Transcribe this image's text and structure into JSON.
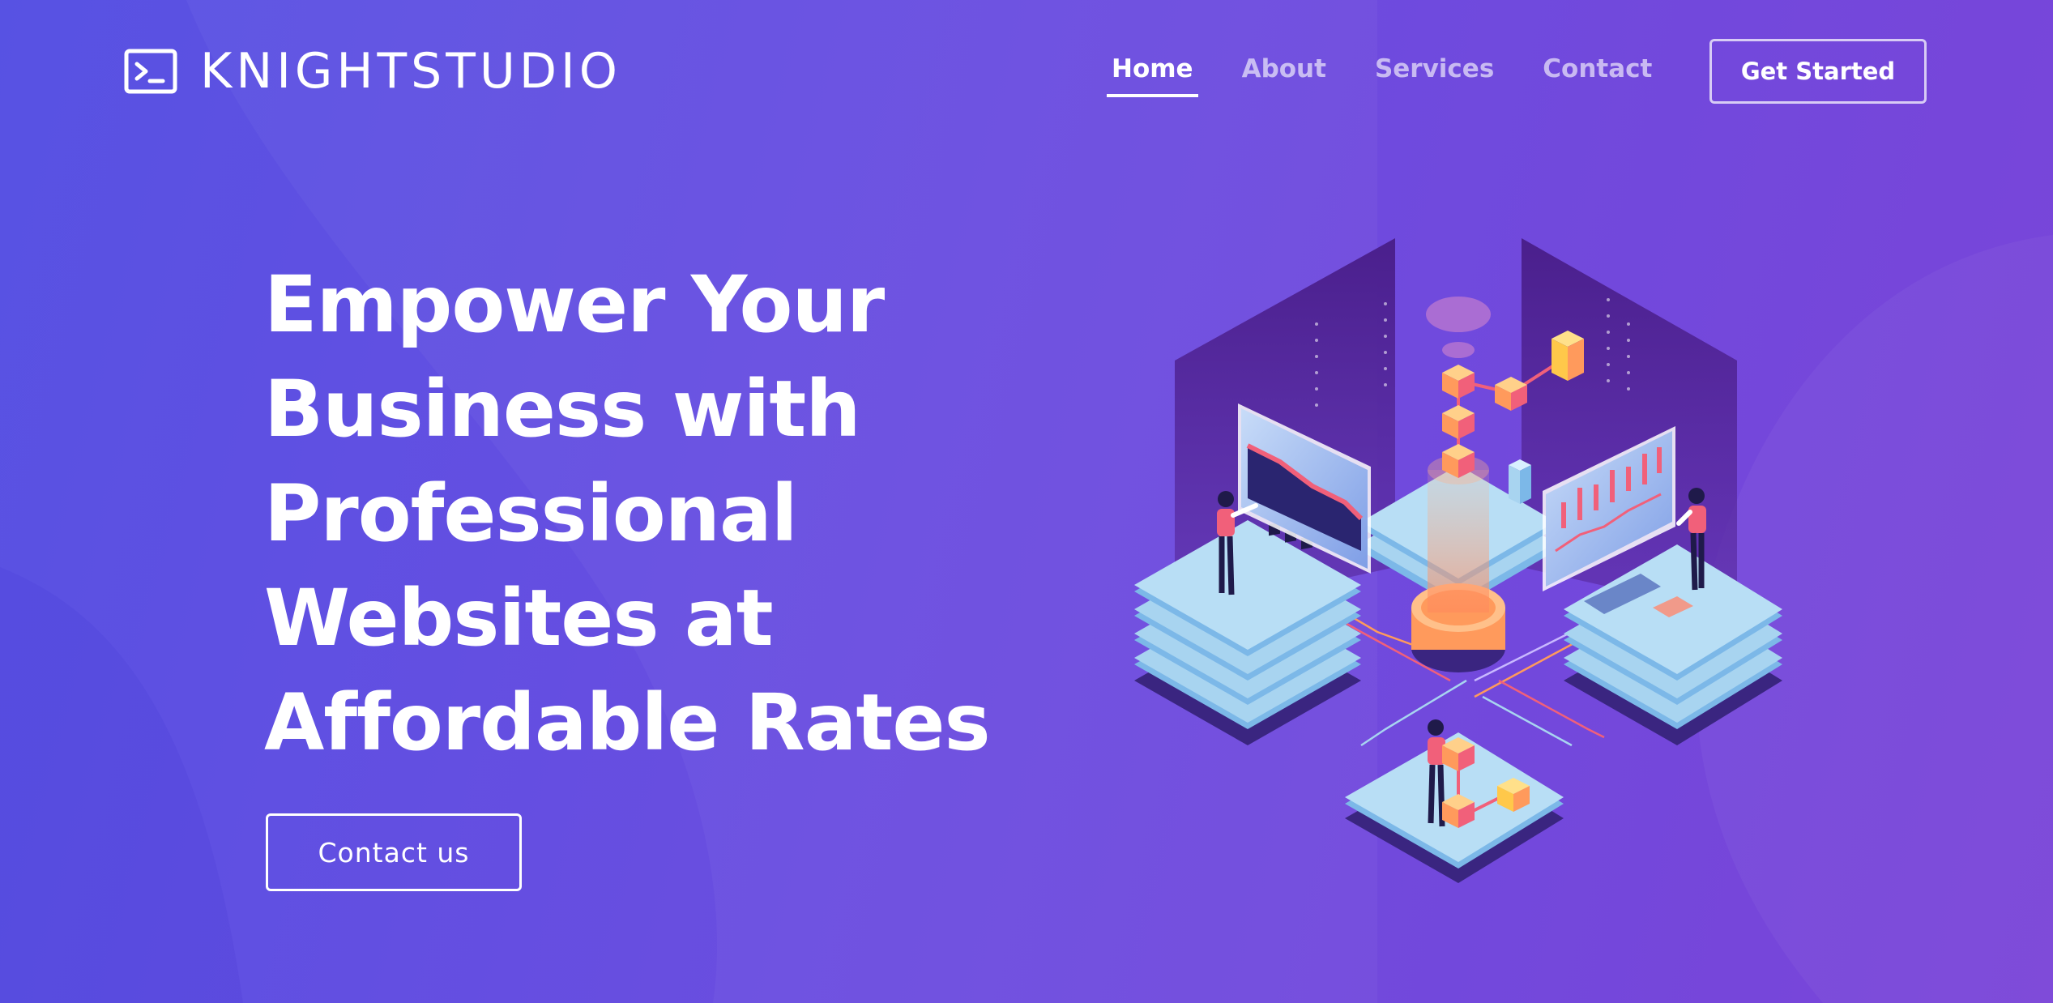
{
  "brand": {
    "name": "KNIGHTSTUDIO",
    "icon": "terminal-icon"
  },
  "nav": {
    "items": [
      {
        "label": "Home",
        "active": true
      },
      {
        "label": "About",
        "active": false
      },
      {
        "label": "Services",
        "active": false
      },
      {
        "label": "Contact",
        "active": false
      }
    ],
    "cta_label": "Get Started"
  },
  "hero": {
    "title_lines": [
      "Empower Your",
      "Business with",
      "Professional",
      "Websites at",
      "Affordable Rates"
    ],
    "button_label": "Contact us",
    "illustration": "isometric-data-platforms-illustration"
  },
  "colors": {
    "background_start": "#5752e3",
    "background_end": "#7a44d8",
    "text": "#ffffff",
    "accent_orange": "#ff9a5c",
    "accent_red": "#f1607a",
    "platform_blue": "#a8d4f0",
    "dark_purple": "#4a2a8a"
  }
}
